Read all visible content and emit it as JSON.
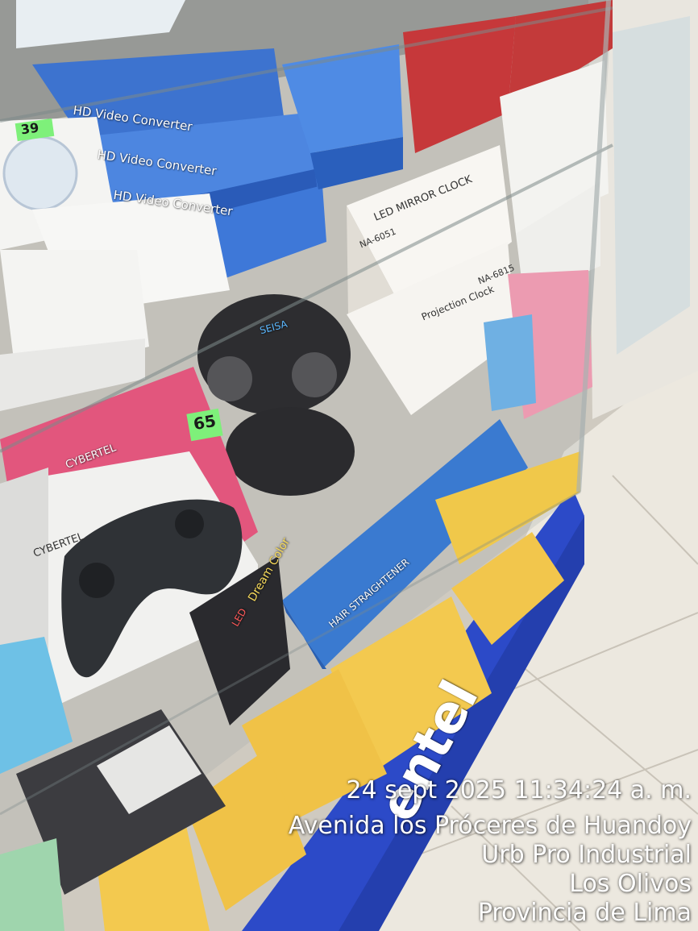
{
  "photo": {
    "subject": "shop-display-case",
    "colors": {
      "wall": "#e6e2d8",
      "floor": "#ece8df",
      "base_stripe": "#2c4ac8",
      "pink_box": "#e2567d",
      "blue_box": "#3570c9",
      "yellow_box": "#f0c84a"
    }
  },
  "labels": {
    "price_39": "39",
    "price_65": "65",
    "hd_converter_1": "HD Video Converter",
    "hd_converter_2": "HD Video Converter",
    "hd_converter_3": "HD Video Converter",
    "led_mirror_clock": "LED MIRROR CLOCK",
    "model_1": "NA-6051",
    "model_2": "NA-6815",
    "projection_clock": "Projection Clock",
    "cybertel_brand": "CYBERTEL",
    "cybertel_brand_2": "CYBERTEL",
    "seisa": "SEISA",
    "dream_color": "Dream Color",
    "led_mini": "LED",
    "hair_straightener": "HAIR STRAIGHTENER",
    "claro_logo": "entel"
  },
  "timestamp": {
    "lines": [
      "24 sept 2025 11:34:24 a. m.",
      "Avenida los Próceres de Huandoy",
      "Urb Pro Industrial",
      "Los Olivos",
      "Provincia de Lima"
    ]
  }
}
